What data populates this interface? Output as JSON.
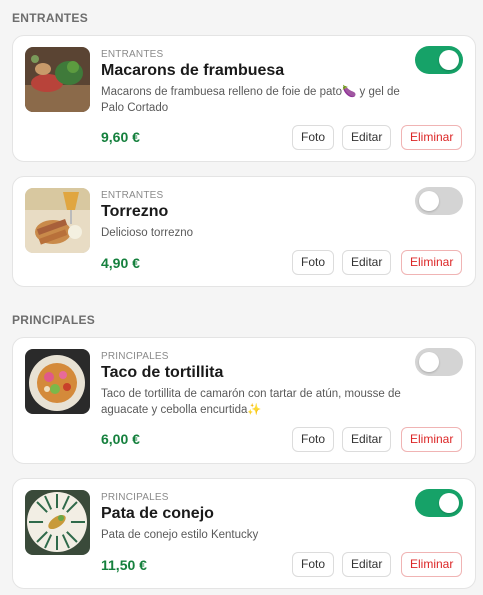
{
  "sections": [
    {
      "title": "ENTRANTES"
    },
    {
      "title": "PRINCIPALES"
    }
  ],
  "items": [
    {
      "category": "ENTRANTES",
      "name": "Macarons de frambuesa",
      "description": "Macarons de frambuesa relleno de foie de pato🍆 y gel de Palo Cortado",
      "price": "9,60 €",
      "active": true
    },
    {
      "category": "ENTRANTES",
      "name": "Torrezno",
      "description": "Delicioso torrezno",
      "price": "4,90 €",
      "active": false
    },
    {
      "category": "PRINCIPALES",
      "name": "Taco de tortillita",
      "description": "Taco de tortillita de camarón con tartar de atún, mousse de aguacate y cebolla encurtida✨",
      "price": "6,00 €",
      "active": false
    },
    {
      "category": "PRINCIPALES",
      "name": "Pata de conejo",
      "description": "Pata de conejo estilo Kentucky",
      "price": "11,50 €",
      "active": true
    }
  ],
  "buttons": {
    "photo": "Foto",
    "edit": "Editar",
    "delete": "Eliminar"
  },
  "colors": {
    "price": "#15803d",
    "toggle_on": "#16a268",
    "toggle_off": "#d4d4d4",
    "delete": "#dc2626"
  }
}
